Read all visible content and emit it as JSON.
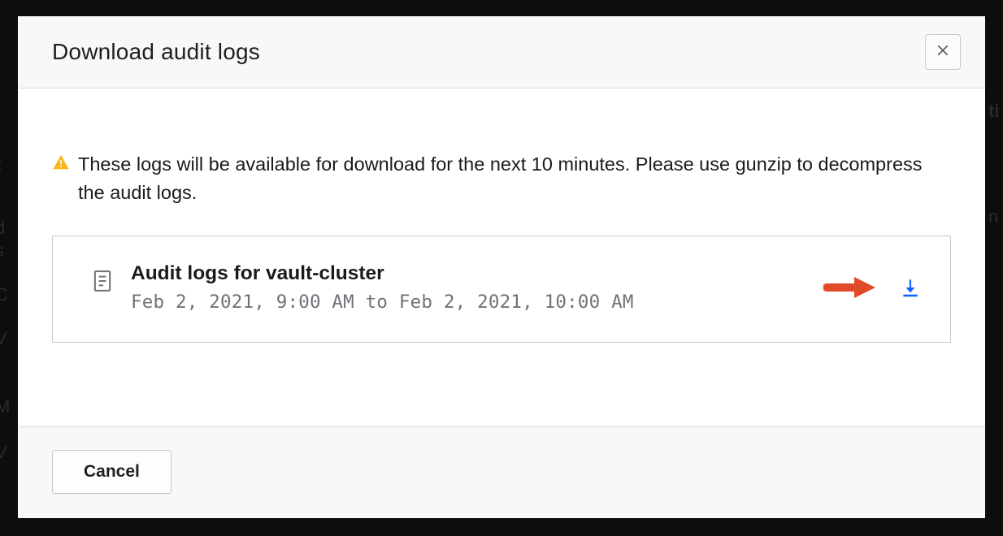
{
  "modal": {
    "title": "Download audit logs",
    "warning": "These logs will be available for download for the next 10 minutes. Please use gunzip to decompress the audit logs.",
    "log": {
      "title": "Audit logs for vault-cluster",
      "range": "Feb 2, 2021, 9:00 AM to Feb 2, 2021, 10:00 AM"
    },
    "cancel_label": "Cancel"
  }
}
